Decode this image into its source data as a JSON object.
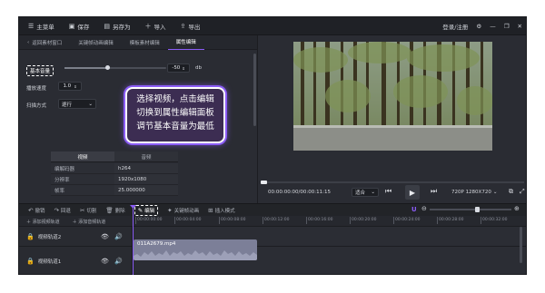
{
  "topbar": {
    "items": [
      {
        "icon": "menu-icon",
        "label": "主菜单"
      },
      {
        "icon": "save-icon",
        "label": "保存"
      },
      {
        "icon": "save-as-icon",
        "label": "另存为"
      },
      {
        "icon": "plus-icon",
        "label": "导入"
      },
      {
        "icon": "export-icon",
        "label": "导出"
      }
    ],
    "login_label": "登录/注册"
  },
  "panel_tabs": {
    "back_label": "返回素材窗口",
    "tabs": [
      "关键帧动画编辑",
      "模板素材编辑",
      "属性编辑"
    ],
    "active_tab": 2
  },
  "properties": {
    "volume_label": "基本音量",
    "volume_value": "-50",
    "volume_unit": "db",
    "volume_level_percent": 42,
    "speed_label": "播放速度",
    "speed_value": "1.0",
    "scan_label": "扫描方式",
    "scan_value": "逐行"
  },
  "info": {
    "tabs": [
      "视频",
      "音频"
    ],
    "active_tab": 0,
    "rows": [
      {
        "key": "编解码器",
        "value": "h264"
      },
      {
        "key": "分辨率",
        "value": "1920x1080"
      },
      {
        "key": "帧率",
        "value": "25.000000"
      }
    ]
  },
  "overlay": {
    "lines": [
      "选择视频，点击编辑",
      "切换到属性编辑面板",
      "调节基本音量为最低"
    ]
  },
  "preview": {
    "timecode": "00:00:00:00/00:00:11:15",
    "fit_label": "适合",
    "resolution_label": "720P 1280X720"
  },
  "toolbar": {
    "tools": [
      {
        "icon": "undo-icon",
        "label": "撤销"
      },
      {
        "icon": "redo-icon",
        "label": "回退"
      },
      {
        "icon": "cut-icon",
        "label": "切割"
      },
      {
        "icon": "delete-icon",
        "label": "删除"
      },
      {
        "icon": "edit-icon",
        "label": "编辑"
      },
      {
        "icon": "keyframe-icon",
        "label": "关键帧动画"
      },
      {
        "icon": "insert-mode-icon",
        "label": "插入模式"
      }
    ],
    "active_tool": 4
  },
  "timeline": {
    "add_video_label": "添加视频轨道",
    "add_audio_label": "添加音频轨道",
    "ticks": [
      "00:00:00:00",
      "00:00:04:00",
      "00:00:08:00",
      "00:00:12:00",
      "00:00:16:00",
      "00:00:20:00",
      "00:00:24:00",
      "00:00:28:00",
      "00:00:32:00"
    ],
    "tracks": [
      {
        "label": "视频轨道2"
      },
      {
        "label": "视频轨道1"
      }
    ],
    "clip_name": "011A2679.mp4"
  },
  "colors": {
    "accent": "#8b5cf6"
  }
}
